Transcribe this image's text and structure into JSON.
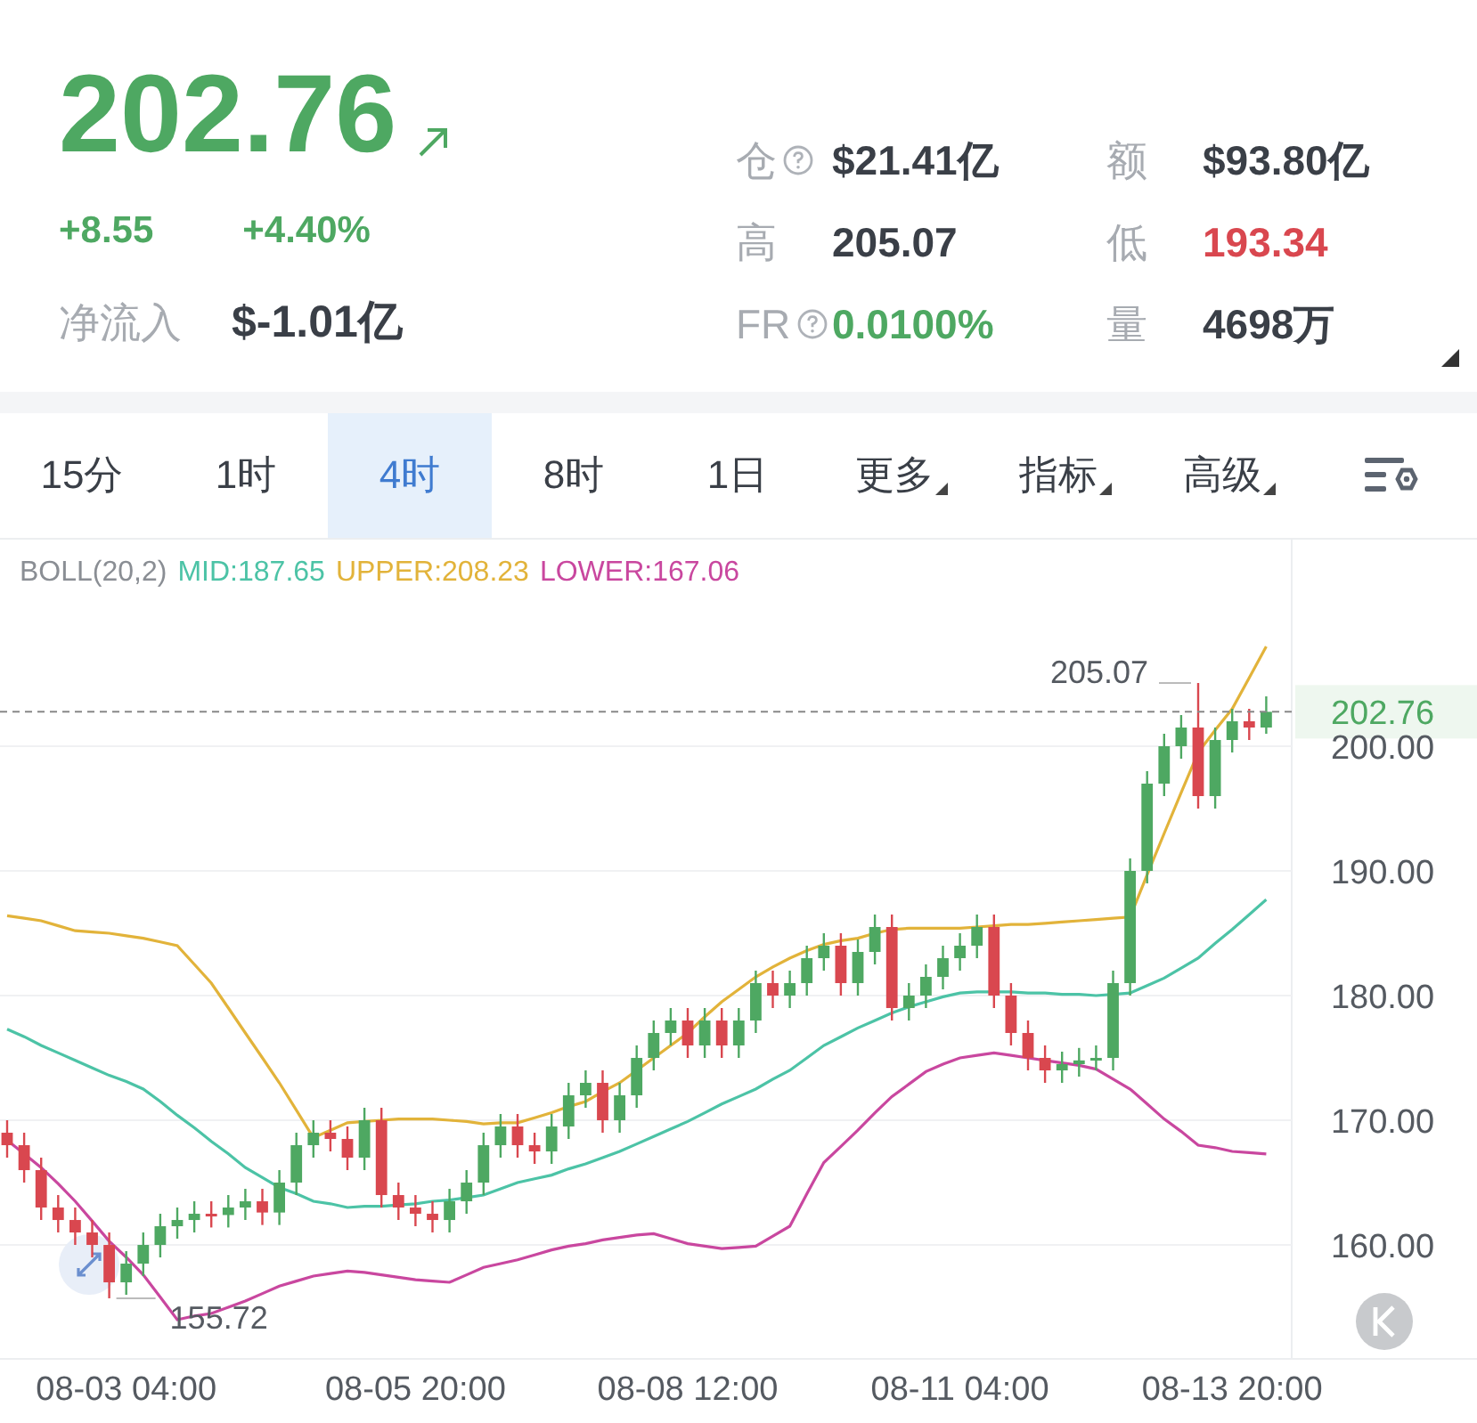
{
  "quote": {
    "price": "202.76",
    "change": "+8.55",
    "change_pct": "+4.40%",
    "net_inflow": {
      "label": "净流入",
      "value": "$-1.01亿"
    },
    "stats": [
      {
        "label": "仓",
        "help": true,
        "value": "$21.41亿",
        "color": "#3a3f47"
      },
      {
        "label": "额",
        "help": false,
        "value": "$93.80亿",
        "color": "#3a3f47"
      },
      {
        "label": "高",
        "help": false,
        "value": "205.07",
        "color": "#3a3f47"
      },
      {
        "label": "低",
        "help": false,
        "value": "193.34",
        "color": "#d9474f"
      },
      {
        "label": "FR",
        "help": true,
        "value": "0.0100%",
        "color": "#4ea862"
      },
      {
        "label": "量",
        "help": false,
        "value": "4698万",
        "color": "#3a3f47"
      }
    ]
  },
  "tabs": [
    {
      "label": "15分",
      "selected": false,
      "dropdown": false
    },
    {
      "label": "1时",
      "selected": false,
      "dropdown": false
    },
    {
      "label": "4时",
      "selected": true,
      "dropdown": false
    },
    {
      "label": "8时",
      "selected": false,
      "dropdown": false
    },
    {
      "label": "1日",
      "selected": false,
      "dropdown": false
    },
    {
      "label": "更多",
      "selected": false,
      "dropdown": true
    },
    {
      "label": "指标",
      "selected": false,
      "dropdown": true
    },
    {
      "label": "高级",
      "selected": false,
      "dropdown": true
    }
  ],
  "indicator": {
    "name": "BOLL(20,2)",
    "items": [
      {
        "text": "MID:187.65",
        "color": "#4cc3a6"
      },
      {
        "text": "UPPER:208.23",
        "color": "#e2b33a"
      },
      {
        "text": "LOWER:167.06",
        "color": "#c9479f"
      }
    ]
  },
  "chart": {
    "chart_data": {
      "type": "candlestick",
      "grid": true,
      "ylim": [
        150.86,
        216.57
      ],
      "categories": [
        null,
        null,
        null,
        null,
        null,
        null,
        null,
        "08-03 04:00",
        null,
        null,
        null,
        null,
        null,
        null,
        null,
        null,
        null,
        null,
        null,
        null,
        null,
        null,
        null,
        null,
        "08-05 20:00",
        null,
        null,
        null,
        null,
        null,
        null,
        null,
        null,
        null,
        null,
        null,
        null,
        null,
        null,
        null,
        "08-08 12:00",
        null,
        null,
        null,
        null,
        null,
        null,
        null,
        null,
        null,
        null,
        null,
        null,
        null,
        null,
        null,
        "08-11 04:00",
        null,
        null,
        null,
        null,
        null,
        null,
        null,
        null,
        null,
        null,
        null,
        null,
        null,
        null,
        null,
        "08-13 20:00",
        null,
        null
      ],
      "ohlc": [
        [
          169,
          170,
          167,
          168
        ],
        [
          168,
          169,
          165,
          166
        ],
        [
          166,
          167,
          162,
          163
        ],
        [
          163,
          164,
          161,
          162
        ],
        [
          162,
          163,
          160,
          161
        ],
        [
          161,
          162,
          159,
          160
        ],
        [
          160,
          161,
          155.72,
          157
        ],
        [
          157,
          159.5,
          156,
          158.5
        ],
        [
          158.5,
          161,
          157.5,
          160
        ],
        [
          160,
          162.5,
          159,
          161.5
        ],
        [
          161.5,
          163,
          160.5,
          162
        ],
        [
          162,
          163.5,
          161,
          162.5
        ],
        [
          162.5,
          163.5,
          161.4,
          162.4
        ],
        [
          162.4,
          164,
          161.4,
          163
        ],
        [
          163,
          164.5,
          162,
          163.5
        ],
        [
          163.5,
          164.5,
          161.6,
          162.6
        ],
        [
          162.6,
          166,
          161.6,
          165
        ],
        [
          165,
          169,
          164,
          168
        ],
        [
          168,
          170,
          167,
          169
        ],
        [
          169,
          170,
          167.5,
          168.5
        ],
        [
          168.5,
          169.5,
          166,
          167
        ],
        [
          167,
          171,
          166,
          170
        ],
        [
          170,
          171,
          163,
          164
        ],
        [
          164,
          165,
          162,
          163
        ],
        [
          163,
          164,
          161.5,
          162.5
        ],
        [
          162.5,
          163.5,
          161,
          162
        ],
        [
          162,
          164.5,
          161,
          163.5
        ],
        [
          163.5,
          166,
          162.5,
          165
        ],
        [
          165,
          169,
          164,
          168
        ],
        [
          168,
          170.5,
          167,
          169.5
        ],
        [
          169.5,
          170.5,
          167,
          168
        ],
        [
          168,
          169,
          166.5,
          167.5
        ],
        [
          167.5,
          170.5,
          166.5,
          169.5
        ],
        [
          169.5,
          173,
          168.5,
          172
        ],
        [
          172,
          174,
          171,
          173
        ],
        [
          173,
          174,
          169,
          170
        ],
        [
          170,
          173,
          169,
          172
        ],
        [
          172,
          176,
          171,
          175
        ],
        [
          175,
          178,
          174,
          177
        ],
        [
          177,
          179,
          176,
          178
        ],
        [
          178,
          179,
          175,
          176
        ],
        [
          176,
          179,
          175,
          178
        ],
        [
          178,
          179,
          175,
          176
        ],
        [
          176,
          179,
          175,
          178
        ],
        [
          178,
          182,
          177,
          181
        ],
        [
          181,
          182,
          179,
          180
        ],
        [
          180,
          182,
          179,
          181
        ],
        [
          181,
          184,
          180,
          183
        ],
        [
          183,
          185,
          182,
          184
        ],
        [
          184,
          185,
          180,
          181
        ],
        [
          181,
          184.5,
          180,
          183.5
        ],
        [
          183.5,
          186.5,
          182.5,
          185.5
        ],
        [
          185.5,
          186.5,
          178,
          179
        ],
        [
          179,
          181,
          178,
          180
        ],
        [
          180,
          182.5,
          179,
          181.5
        ],
        [
          181.5,
          184,
          180.5,
          183
        ],
        [
          183,
          185,
          182,
          184
        ],
        [
          184,
          186.5,
          183,
          185.5
        ],
        [
          185.5,
          186.5,
          179,
          180
        ],
        [
          180,
          181,
          176,
          177
        ],
        [
          177,
          178,
          174,
          175
        ],
        [
          175,
          176,
          173,
          174
        ],
        [
          174,
          175.5,
          173,
          174.5
        ],
        [
          174.5,
          175.8,
          173.5,
          174.8
        ],
        [
          174.8,
          176,
          174,
          175
        ],
        [
          175,
          182,
          174,
          181
        ],
        [
          181,
          191,
          180,
          190
        ],
        [
          190,
          198,
          189,
          197
        ],
        [
          197,
          201,
          196,
          200
        ],
        [
          200,
          202.5,
          199,
          201.5
        ],
        [
          201.5,
          205.07,
          195,
          196
        ],
        [
          196,
          201.5,
          195,
          200.5
        ],
        [
          200.5,
          203,
          199.5,
          202
        ],
        [
          202,
          203,
          200.5,
          201.5
        ],
        [
          201.5,
          204,
          201,
          202.76
        ]
      ],
      "yticks": [
        {
          "value": 160,
          "label": "160.00"
        },
        {
          "value": 170,
          "label": "170.00"
        },
        {
          "value": 180,
          "label": "180.00"
        },
        {
          "value": 190,
          "label": "190.00"
        },
        {
          "value": 200,
          "label": "200.00"
        }
      ],
      "series": [
        {
          "type": "line",
          "color": "#e2b33a",
          "values": [
            186.4,
            186.2,
            186.0,
            185.6,
            185.2,
            185.1,
            185.0,
            184.8,
            184.6,
            184.3,
            184.0,
            182.5,
            181,
            179,
            177,
            175,
            173,
            170.8,
            168.6,
            169.2,
            169.8,
            169.9,
            170,
            170.1,
            170.1,
            170.1,
            170,
            169.9,
            169.7,
            169.8,
            169.8,
            170.2,
            170.6,
            171.1,
            171.5,
            172.3,
            173,
            174,
            175,
            176,
            177,
            178.3,
            179.5,
            180.5,
            181.5,
            182.3,
            183,
            183.6,
            184.1,
            184.4,
            184.6,
            185,
            185.3,
            185.4,
            185.4,
            185.4,
            185.4,
            185.5,
            185.6,
            185.7,
            185.7,
            185.8,
            185.9,
            186,
            186.1,
            186.2,
            186.3,
            189.7,
            193,
            196.3,
            199.5,
            201.3,
            203,
            205.5,
            208
          ]
        },
        {
          "type": "line",
          "color": "#4cc3a6",
          "values": [
            177.3,
            176.7,
            176,
            175.4,
            174.8,
            174.2,
            173.6,
            173.1,
            172.5,
            171.5,
            170.4,
            169.4,
            168.3,
            167.3,
            166.2,
            165.4,
            164.6,
            164.1,
            163.5,
            163.3,
            163,
            163.1,
            163.1,
            163.2,
            163.3,
            163.5,
            163.6,
            163.8,
            164,
            164.5,
            165,
            165.3,
            165.6,
            166.1,
            166.5,
            167,
            167.5,
            168.1,
            168.7,
            169.3,
            169.9,
            170.6,
            171.3,
            171.9,
            172.5,
            173.3,
            174,
            175,
            176,
            176.7,
            177.4,
            178,
            178.6,
            179.1,
            179.5,
            179.9,
            180.2,
            180.3,
            180.3,
            180.3,
            180.2,
            180.2,
            180.1,
            180.1,
            180,
            180.1,
            180.2,
            180.8,
            181.4,
            182.2,
            183,
            184.2,
            185.3,
            186.5,
            187.7
          ]
        },
        {
          "type": "line",
          "color": "#c9479f",
          "values": [
            168.4,
            167.3,
            166.2,
            164.9,
            163.5,
            161.9,
            160.3,
            159,
            157.6,
            155.8,
            154,
            154.3,
            154.5,
            155,
            155.5,
            156.1,
            156.7,
            157.1,
            157.5,
            157.7,
            157.9,
            157.8,
            157.6,
            157.4,
            157.2,
            157.1,
            157,
            157.6,
            158.2,
            158.5,
            158.8,
            159.2,
            159.6,
            159.9,
            160.1,
            160.4,
            160.6,
            160.8,
            160.9,
            160.5,
            160.1,
            159.9,
            159.7,
            159.8,
            159.9,
            160.7,
            161.5,
            164.1,
            166.6,
            167.9,
            169.2,
            170.6,
            171.9,
            172.9,
            173.9,
            174.5,
            175,
            175.2,
            175.4,
            175.2,
            175,
            174.8,
            174.6,
            174.4,
            174.1,
            173.3,
            172.5,
            171.3,
            170.1,
            169.1,
            168,
            167.8,
            167.5,
            167.4,
            167.3
          ]
        }
      ],
      "annotations": [
        "205.07",
        "155.72"
      ],
      "ref_lines": [
        {
          "axis": "y",
          "value": 202.76,
          "label": "202.76"
        }
      ]
    }
  }
}
